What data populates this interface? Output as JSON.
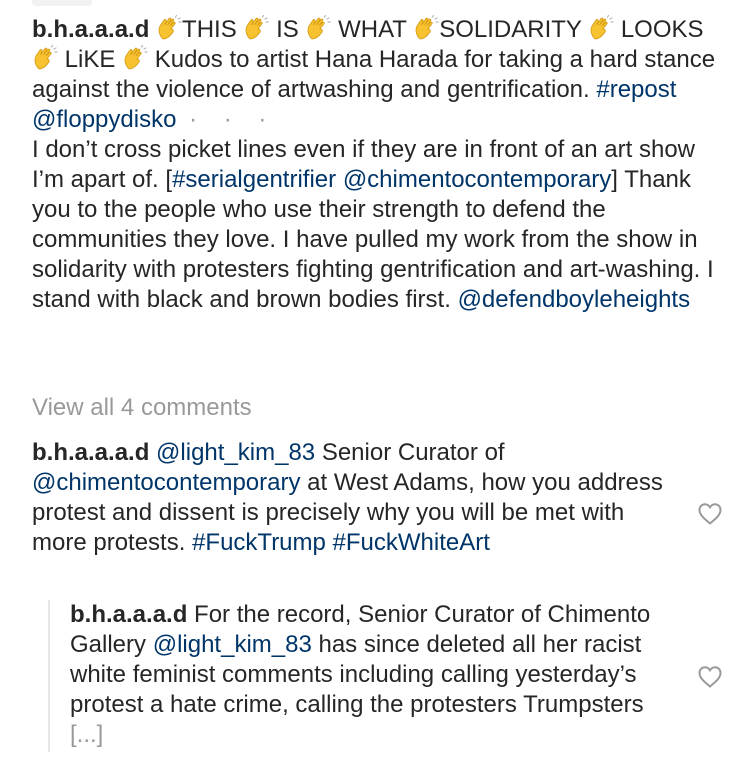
{
  "caption": {
    "username": "b.h.a.a.a.d",
    "line1_parts": [
      "THIS",
      "IS",
      "WHAT",
      "SOLIDARITY"
    ],
    "line2_parts": [
      "LOOKS",
      "LiKE"
    ],
    "line2_text": "Kudos to artist Hana Harada for taking a hard stance against the violence of artwashing and gentrification.",
    "hashtag_repost": "#repost",
    "mention_floppydisko": "@floppydisko",
    "more_dots": "· · ·",
    "body_1": "I don’t cross picket lines even if they are in front of an art show I’m apart of. [",
    "hashtag_serial": "#serialgentrifier",
    "mention_chimento": "@chimentocontemporary",
    "body_2": "] Thank you to the people who use their strength to defend the communities they love. I have pulled my work from the show in solidarity with protesters fighting gentrification and art-washing. I stand with black and brown bodies first.",
    "mention_defend": "@defendboyleheights"
  },
  "view_all_comments": "View all 4 comments",
  "comment1": {
    "username": "b.h.a.a.a.d",
    "mention_light": "@light_kim_83",
    "text_1": "Senior Curator of",
    "mention_chimento": "@chimentocontemporary",
    "text_2": "at West Adams, how you address protest and dissent is precisely why you will be met with more protests.",
    "hashtag_trump": "#FuckTrump",
    "hashtag_whiteart": "#FuckWhiteArt"
  },
  "comment2": {
    "username": "b.h.a.a.a.d",
    "text_1": "For the record, Senior Curator of Chimento Gallery",
    "mention_light": "@light_kim_83",
    "text_2": "has since deleted all her racist white feminist comments including calling yesterday’s protest a hate crime, calling the protesters Trumpsters",
    "truncation": "[...]"
  },
  "icons": {
    "emoji": "clapping-hands-icon",
    "like": "heart-outline-icon"
  },
  "colors": {
    "text": "#262626",
    "link": "#003569",
    "muted": "#999999"
  }
}
